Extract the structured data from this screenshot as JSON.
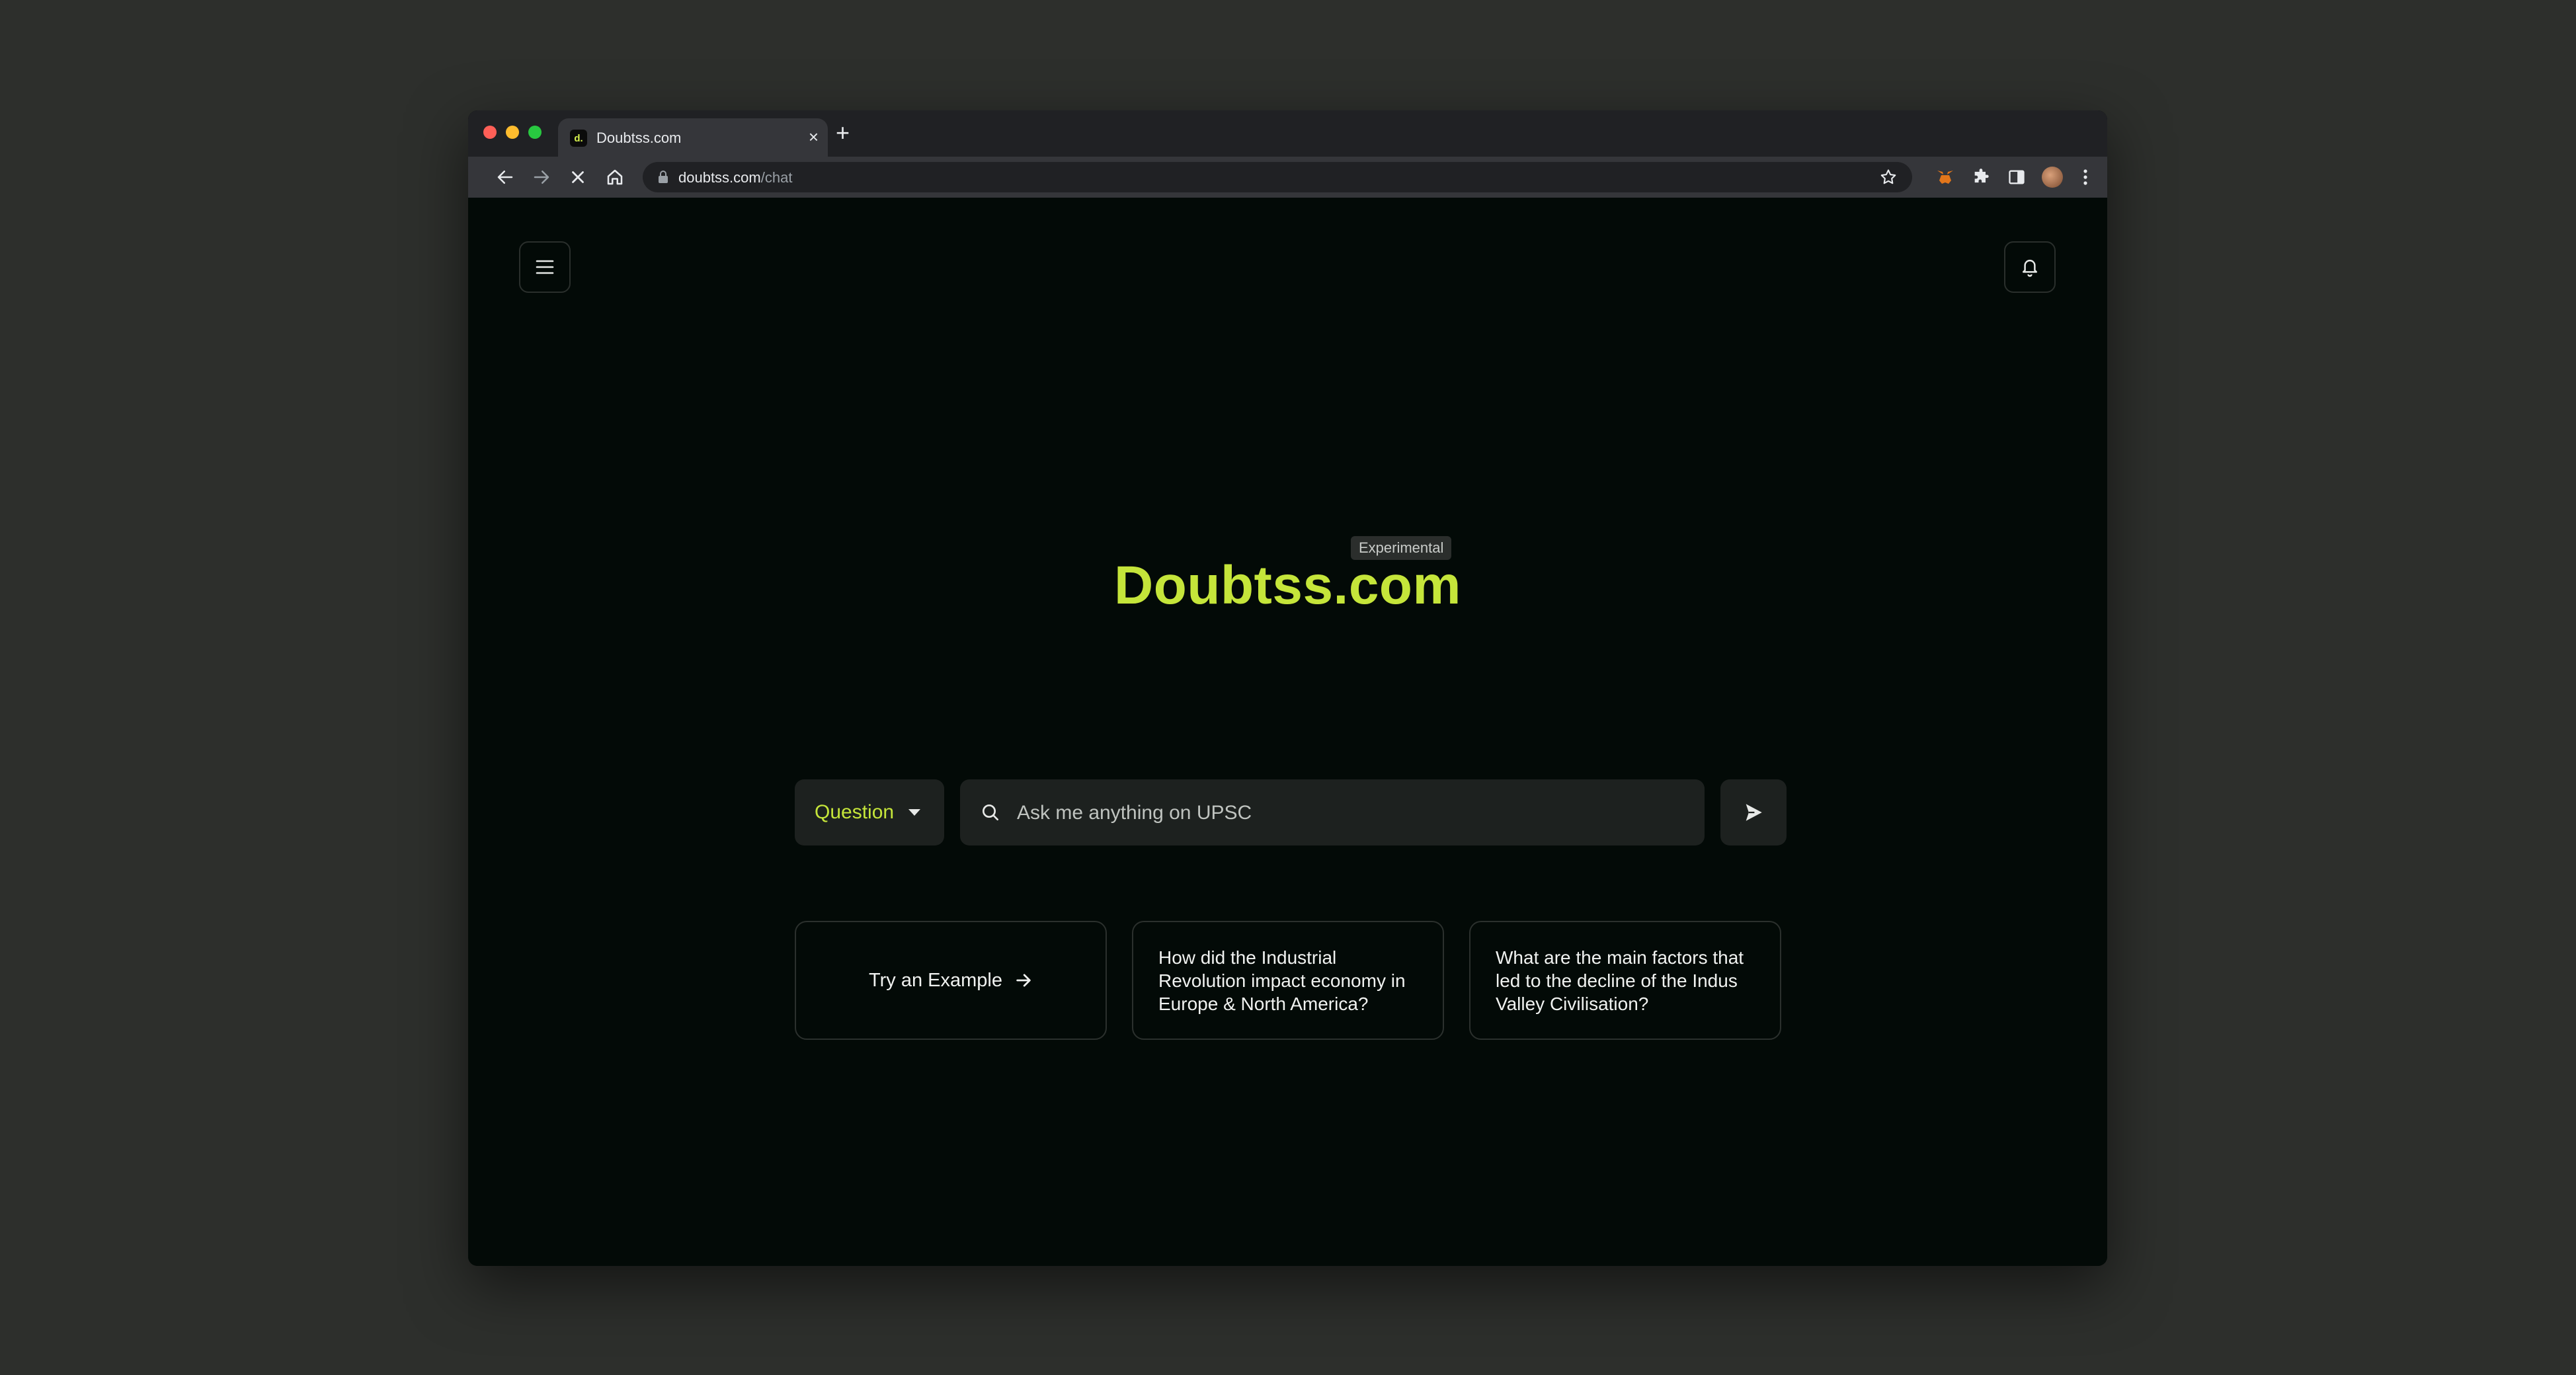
{
  "browser": {
    "tab_title": "Doubtss.com",
    "favicon_text": "d.",
    "tab_close": "×",
    "new_tab": "+",
    "url_domain": "doubtss.com",
    "url_path": "/chat"
  },
  "header": {
    "menu_icon": "hamburger-menu-icon",
    "notification_icon": "bell-icon"
  },
  "hero": {
    "badge": "Experimental",
    "brand": "Doubtss.com"
  },
  "search": {
    "mode_value": "Question",
    "placeholder": "Ask me anything on UPSC",
    "value": ""
  },
  "examples": {
    "try_label": "Try an Example",
    "cards": [
      "How did the Industrial Revolution impact economy in Europe & North America?",
      "What are the main factors that led to the decline of the Indus Valley Civilisation?"
    ]
  },
  "colors": {
    "accent": "#c5e53a",
    "page_bg": "#030a07",
    "field_bg": "#1d211f",
    "desktop_bg": "#2d2f2c"
  }
}
